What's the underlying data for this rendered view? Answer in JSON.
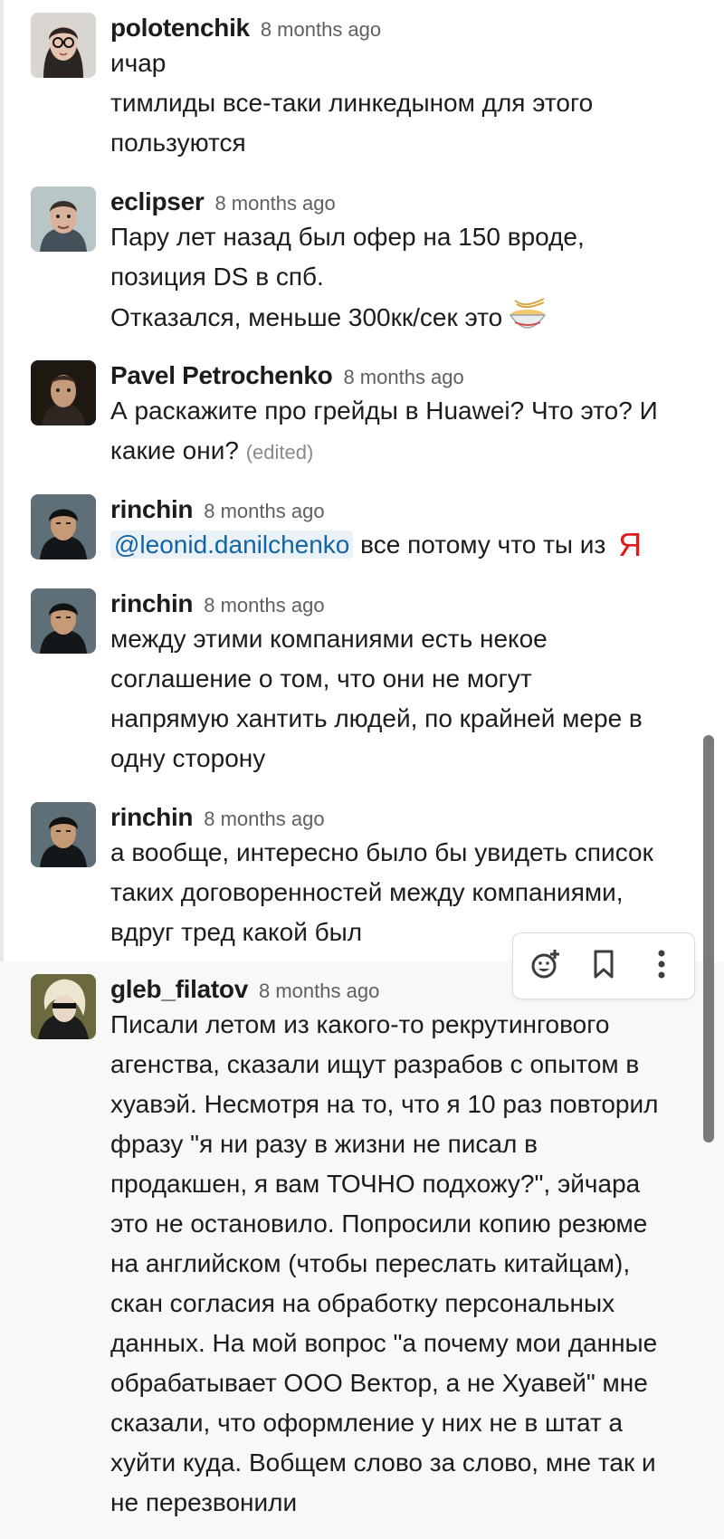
{
  "messages": [
    {
      "author": "polotenchik",
      "time": "8 months ago",
      "lines": [
        "ичар",
        "тимлиды все-таки линкедыном для этого",
        "пользуются"
      ]
    },
    {
      "author": "eclipser",
      "time": "8 months ago",
      "lines": [
        "Пару лет назад был офер на 150 вроде,",
        "позиция DS в спб.",
        "Отказался, меньше 300кк/сек это"
      ],
      "emoji": "ramen-bowl-icon"
    },
    {
      "author": "Pavel Petrochenko",
      "time": "8 months ago",
      "lines": [
        "А раскажите про грейды в Huawei? Что это? И",
        "какие они?"
      ],
      "edited": "(edited)"
    },
    {
      "author": "rinchin",
      "time": "8 months ago",
      "mention": "@leonid.danilchenko",
      "text_after_mention": "все потому что ты из",
      "yandex_glyph": "Я"
    },
    {
      "author": "rinchin",
      "time": "8 months ago",
      "lines": [
        "между этими компаниями есть некое",
        "соглашение о том, что они не могут",
        "напрямую хантить людей, по крайней мере в",
        "одну сторону"
      ]
    },
    {
      "author": "rinchin",
      "time": "8 months ago",
      "lines": [
        "а вообще, интересно было бы увидеть список",
        "таких договоренностей между компаниями,",
        "вдруг тред какой был"
      ]
    },
    {
      "author": "gleb_filatov",
      "time": "8 months ago",
      "lines": [
        "Писали летом из какого-то рекрутингового",
        "агенства, сказали ищут разрабов с опытом в",
        "хуавэй. Несмотря на то, что я 10 раз повторил",
        "фразу \"я ни разу в жизни не писал в",
        "продакшен, я вам ТОЧНО подхожу?\", эйчара",
        "это не остановило. Попросили копию резюме",
        "на английском (чтобы переслать китайцам),",
        "скан согласия на обработку персональных",
        "данных. На мой вопрос \"а почему мои данные",
        "обрабатывает ООО Вектор, а не Хуавей\" мне",
        "сказали, что оформление у них не в штат а",
        "хуйти куда. Вобщем слово за слово, мне так и",
        "не перезвонили"
      ]
    }
  ],
  "hover_actions": [
    "add-reaction-icon",
    "bookmark-icon",
    "more-actions-icon"
  ]
}
